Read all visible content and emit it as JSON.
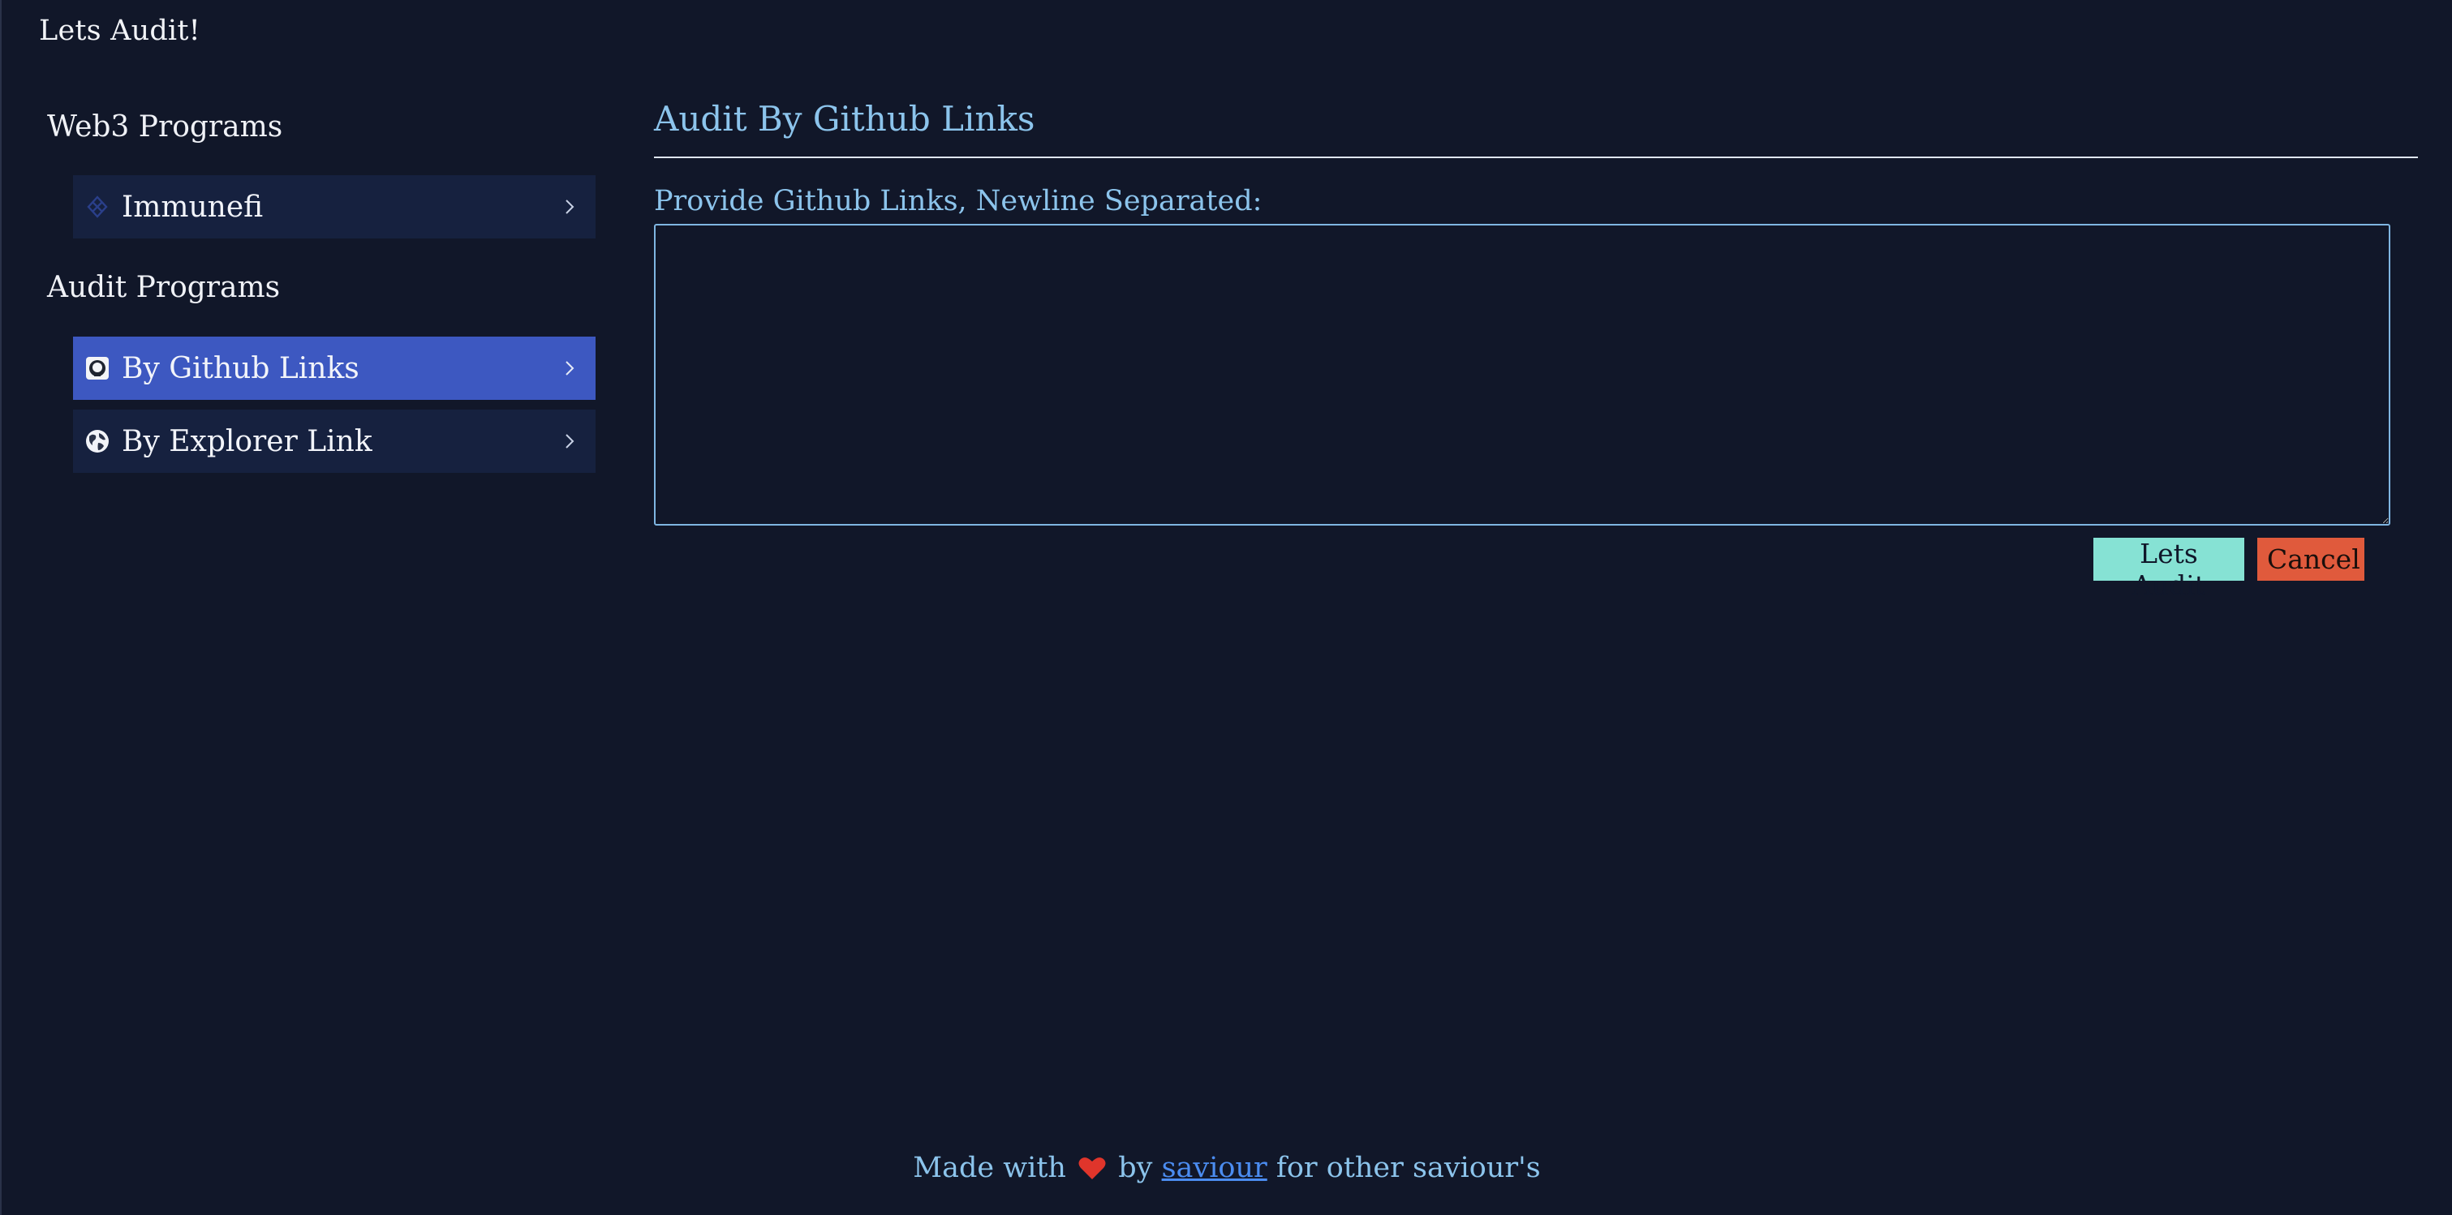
{
  "app": {
    "title": "Lets Audit!"
  },
  "sidebar": {
    "sections": [
      {
        "heading": "Web3 Programs",
        "items": [
          {
            "label": "Immunefi",
            "icon": "immunefi-icon",
            "active": false
          }
        ]
      },
      {
        "heading": "Audit Programs",
        "items": [
          {
            "label": "By Github Links",
            "icon": "github-icon",
            "active": true
          },
          {
            "label": "By Explorer Link",
            "icon": "globe-icon",
            "active": false
          }
        ]
      }
    ]
  },
  "main": {
    "title": "Audit By Github Links",
    "field_label": "Provide Github Links, Newline Separated:",
    "textarea_value": "",
    "submit_label": "Lets Audit",
    "cancel_label": "Cancel"
  },
  "footer": {
    "made_with": "Made with",
    "by": "by",
    "author_link": "saviour",
    "suffix": "for other saviour's"
  },
  "colors": {
    "background": "#111729",
    "accent_text": "#8cc4ec",
    "active_item": "#3d58c1",
    "item_bg": "#16213f",
    "submit_button": "#86e2d4",
    "cancel_button": "#e05a3c",
    "heart": "#e0352b",
    "link": "#4b8cf0"
  }
}
